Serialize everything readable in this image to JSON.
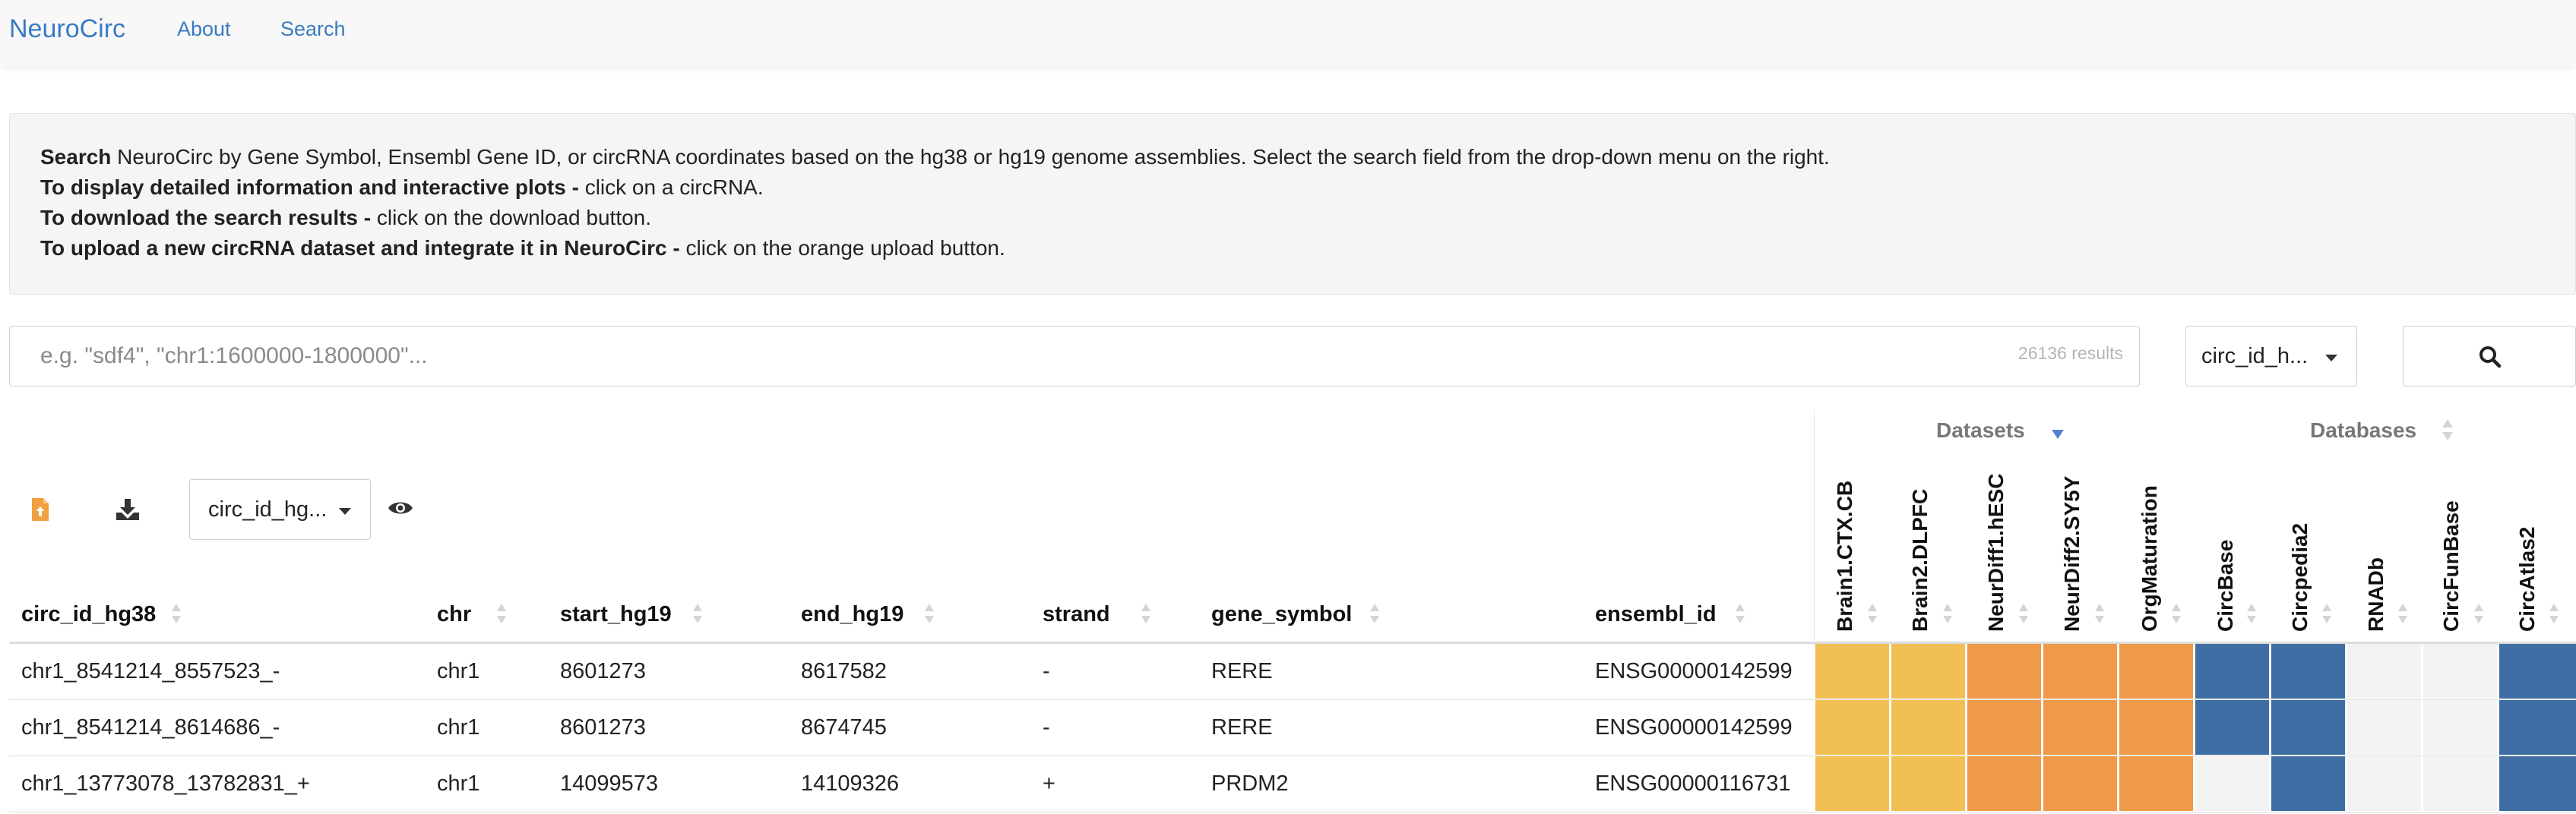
{
  "nav": {
    "brand": "NeuroCirc",
    "links": [
      "About",
      "Search"
    ]
  },
  "info": {
    "line1_bold": "Search",
    "line1_text": " NeuroCirc by Gene Symbol, Ensembl Gene ID, or circRNA coordinates based on the hg38 or hg19 genome assemblies. Select the search field from the drop-down menu on the right.",
    "line2_bold": "To display detailed information and interactive plots -",
    "line2_text": " click on a circRNA.",
    "line3_bold": "To download the search results -",
    "line3_text": " click on the download button.",
    "line4_bold": "To upload a new circRNA dataset and integrate it in NeuroCirc -",
    "line4_text": " click on the orange upload button."
  },
  "search": {
    "placeholder": "e.g. \"sdf4\", \"chr1:1600000-1800000\"...",
    "results": "26136 results",
    "field_select": "circ_id_h..."
  },
  "toolbar": {
    "column_select": "circ_id_hg..."
  },
  "groups": {
    "datasets": "Datasets",
    "databases": "Databases"
  },
  "colors": {
    "brain": "#f2bf55",
    "neurdiff": "#ef9a48",
    "database": "#3e6ea3",
    "empty": "#f3f3f3",
    "upload": "#f0a040",
    "link": "#3a7bc2"
  },
  "columns": [
    "circ_id_hg38",
    "chr",
    "start_hg19",
    "end_hg19",
    "strand",
    "gene_symbol",
    "ensembl_id"
  ],
  "heat_columns": [
    "Brain1.CTX.CB",
    "Brain2.DLPFC",
    "NeurDiff1.hESC",
    "NeurDiff2.SY5Y",
    "OrgMaturation",
    "CircBase",
    "Circpedia2",
    "RNADb",
    "CircFunBase",
    "CircAtlas2"
  ],
  "rows": [
    {
      "cells": [
        "chr1_8541214_8557523_-",
        "chr1",
        "8601273",
        "8617582",
        "-",
        "RERE",
        "ENSG00000142599"
      ],
      "heat": [
        "brain",
        "brain",
        "neurdiff",
        "neurdiff",
        "neurdiff",
        "database",
        "database",
        "empty",
        "empty",
        "database"
      ]
    },
    {
      "cells": [
        "chr1_8541214_8614686_-",
        "chr1",
        "8601273",
        "8674745",
        "-",
        "RERE",
        "ENSG00000142599"
      ],
      "heat": [
        "brain",
        "brain",
        "neurdiff",
        "neurdiff",
        "neurdiff",
        "database",
        "database",
        "empty",
        "empty",
        "database"
      ]
    },
    {
      "cells": [
        "chr1_13773078_13782831_+",
        "chr1",
        "14099573",
        "14109326",
        "+",
        "PRDM2",
        "ENSG00000116731"
      ],
      "heat": [
        "brain",
        "brain",
        "neurdiff",
        "neurdiff",
        "neurdiff",
        "empty",
        "database",
        "empty",
        "empty",
        "database"
      ]
    }
  ]
}
